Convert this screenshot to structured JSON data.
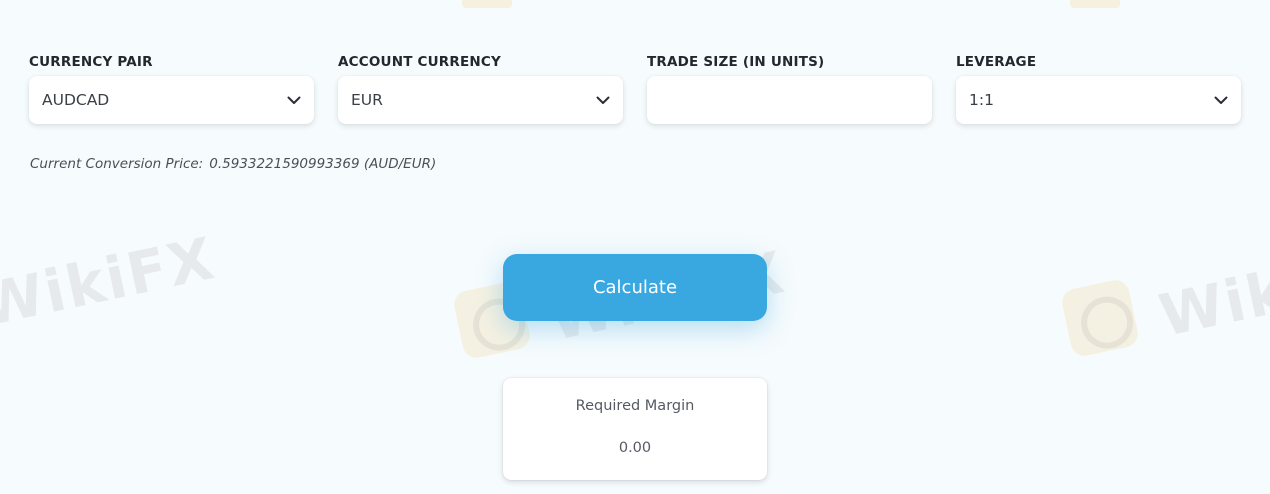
{
  "fields": {
    "currency_pair": {
      "label": "CURRENCY PAIR",
      "value": "AUDCAD"
    },
    "account_currency": {
      "label": "ACCOUNT CURRENCY",
      "value": "EUR"
    },
    "trade_size": {
      "label": "TRADE SIZE (IN UNITS)",
      "value": ""
    },
    "leverage": {
      "label": "LEVERAGE",
      "value": "1:1"
    }
  },
  "conversion": {
    "label": "Current Conversion Price:",
    "value": "0.5933221590993369 (AUD/EUR)"
  },
  "calculate_button": {
    "label": "Calculate"
  },
  "result": {
    "label": "Required Margin",
    "value": "0.00"
  },
  "watermark": {
    "text": "WikiFX"
  },
  "colors": {
    "accent": "#39a7e0",
    "background": "#f6fbfd"
  },
  "icons": {
    "dropdown": "chevron-down-icon"
  }
}
